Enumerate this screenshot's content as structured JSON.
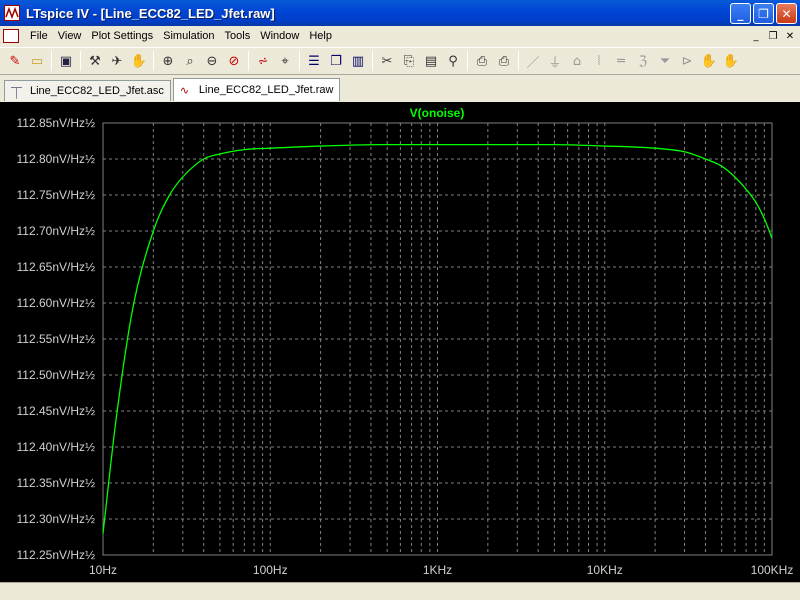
{
  "window": {
    "title": "LTspice IV - [Line_ECC82_LED_Jfet.raw]",
    "buttons": {
      "minimize": "_",
      "restore": "❐",
      "close": "✕"
    }
  },
  "menu": {
    "items": [
      "File",
      "View",
      "Plot Settings",
      "Simulation",
      "Tools",
      "Window",
      "Help"
    ],
    "mdi_buttons": [
      "_",
      "❐",
      "✕"
    ]
  },
  "toolbar": {
    "icons": [
      "new-schematic-icon",
      "open-icon",
      "save-icon",
      "control-panel-icon",
      "run-icon",
      "halt-icon",
      "zoom-in-icon",
      "zoom-out-icon",
      "zoom-rect-icon",
      "zoom-cancel-icon",
      "autorange-icon",
      "cursor-icon",
      "tile-horizontal-icon",
      "cascade-icon",
      "tile-vertical-icon",
      "cut-icon",
      "copy-icon",
      "paste-icon",
      "find-icon",
      "print-setup-icon",
      "print-icon",
      "wire-icon",
      "ground-icon",
      "label-icon",
      "resistor-icon",
      "capacitor-icon",
      "inductor-icon",
      "diode-icon",
      "component-icon",
      "move-icon",
      "drag-icon"
    ]
  },
  "tabs": [
    {
      "label": "Line_ECC82_LED_Jfet.asc",
      "icon": "schematic-icon",
      "active": false
    },
    {
      "label": "Line_ECC82_LED_Jfet.raw",
      "icon": "waveform-icon",
      "active": true
    }
  ],
  "plot": {
    "trace_label": "V(onoise)",
    "trace_color": "#00ff00",
    "background": "#000000",
    "grid_color": "#808080",
    "y_tick_labels": [
      "112.85nV/Hz½",
      "112.80nV/Hz½",
      "112.75nV/Hz½",
      "112.70nV/Hz½",
      "112.65nV/Hz½",
      "112.60nV/Hz½",
      "112.55nV/Hz½",
      "112.50nV/Hz½",
      "112.45nV/Hz½",
      "112.40nV/Hz½",
      "112.35nV/Hz½",
      "112.30nV/Hz½",
      "112.25nV/Hz½"
    ],
    "x_tick_labels": [
      "10Hz",
      "100Hz",
      "1KHz",
      "10KHz",
      "100KHz"
    ]
  },
  "chart_data": {
    "type": "line",
    "title": "V(onoise)",
    "x_scale": "log",
    "xlim": [
      10,
      100000
    ],
    "ylim": [
      112.25,
      112.85
    ],
    "ylabel_unit": "nV/Hz½",
    "series": [
      {
        "name": "V(onoise)",
        "color": "#00ff00",
        "x": [
          10,
          12,
          15,
          20,
          25,
          30,
          40,
          50,
          70,
          100,
          200,
          500,
          1000,
          2000,
          5000,
          10000,
          20000,
          30000,
          40000,
          50000,
          60000,
          70000,
          80000,
          90000,
          100000
        ],
        "y": [
          112.28,
          112.44,
          112.59,
          112.7,
          112.75,
          112.775,
          112.8,
          112.807,
          112.813,
          112.815,
          112.818,
          112.82,
          112.82,
          112.82,
          112.82,
          112.818,
          112.815,
          112.81,
          112.8,
          112.79,
          112.775,
          112.758,
          112.74,
          112.717,
          112.69
        ]
      }
    ]
  }
}
